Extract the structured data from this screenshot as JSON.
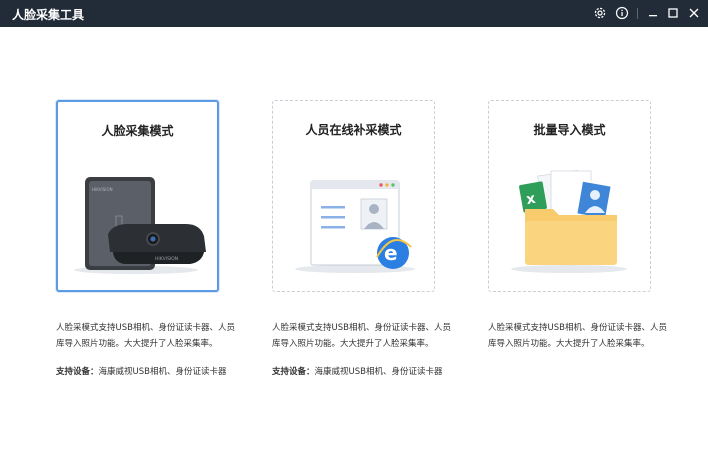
{
  "app": {
    "title": "人脸采集工具",
    "window_controls": [
      "settings-icon",
      "info-icon",
      "minimize-icon",
      "maximize-icon",
      "close-icon"
    ]
  },
  "modes": [
    {
      "title": "人脸采集模式",
      "selected": true,
      "description": "人脸采模式支持USB相机、身份证读卡器、人员库导入照片功能。大大提升了人脸采集率。",
      "support_label": "支持设备：",
      "support_value": "海康威视USB相机、身份证读卡器",
      "illustration": "hikvision-devices",
      "brand_text": "HIKVISION"
    },
    {
      "title": "人员在线补采模式",
      "selected": false,
      "description": "人脸采模式支持USB相机、身份证读卡器、人员库导入照片功能。大大提升了人脸采集率。",
      "support_label": "支持设备：",
      "support_value": "海康威视USB相机、身份证读卡器",
      "illustration": "browser-window"
    },
    {
      "title": "批量导入模式",
      "selected": false,
      "description": "人脸采模式支持USB相机、身份证读卡器、人员库导入照片功能。大大提升了人脸采集率。",
      "illustration": "folder-with-files"
    }
  ],
  "colors": {
    "titlebar": "#222b38",
    "accent": "#5b9be6",
    "folder": "#f8cb6c",
    "excel": "#2e9e5a",
    "ie": "#2b7fe3"
  }
}
